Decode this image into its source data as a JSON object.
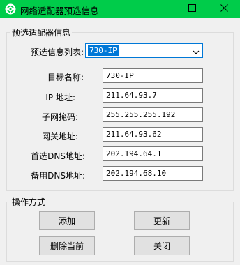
{
  "window": {
    "title": "网络适配器预选信息",
    "icon": "gear-icon",
    "titlebar_color": "#00cc4a",
    "controls": [
      "minimize-icon",
      "maximize-icon",
      "close-icon"
    ]
  },
  "adapter_group": {
    "legend": "预选适配器信息",
    "preset_list": {
      "label": "预选信息列表:",
      "selected": "730-IP"
    },
    "fields": [
      {
        "label": "目标名称:",
        "value": "730-IP"
      },
      {
        "label": "IP 地址:",
        "value": "211.64.93.7"
      },
      {
        "label": "子网掩码:",
        "value": "255.255.255.192"
      },
      {
        "label": "网关地址:",
        "value": "211.64.93.62"
      },
      {
        "label": "首选DNS地址:",
        "value": "202.194.64.1"
      },
      {
        "label": "备用DNS地址:",
        "value": "202.194.68.10"
      }
    ]
  },
  "actions_group": {
    "legend": "操作方式",
    "buttons": {
      "add": "添加",
      "update": "更新",
      "delete_current": "删除当前",
      "close": "关闭"
    }
  }
}
